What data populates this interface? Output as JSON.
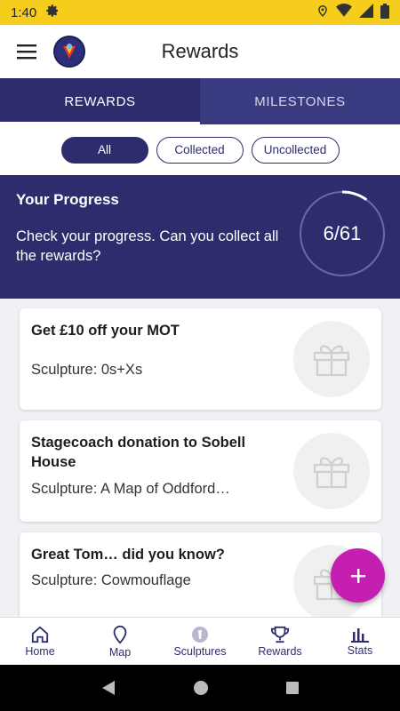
{
  "status_bar": {
    "time": "1:40"
  },
  "app_bar": {
    "title": "Rewards"
  },
  "tabs": [
    {
      "label": "REWARDS",
      "active": true
    },
    {
      "label": "MILESTONES",
      "active": false
    }
  ],
  "filters": {
    "all": "All",
    "collected": "Collected",
    "uncollected": "Uncollected",
    "selected": "All"
  },
  "progress": {
    "title": "Your Progress",
    "text": "Check your progress. Can you collect all the rewards?",
    "count_label": "6/61",
    "collected": 6,
    "total": 61
  },
  "rewards": [
    {
      "title": "Get £10 off your MOT",
      "sculpture": "Sculpture: 0s+Xs"
    },
    {
      "title": "Stagecoach donation to Sobell House",
      "sculpture": "Sculpture: A Map of Oddford…"
    },
    {
      "title": "Great Tom… did you know?",
      "sculpture": "Sculpture: Cowmouflage"
    }
  ],
  "fab": {
    "symbol": "+"
  },
  "bottom_nav": [
    {
      "label": "Home",
      "icon": "home-icon"
    },
    {
      "label": "Map",
      "icon": "map-pin-icon"
    },
    {
      "label": "Sculptures",
      "icon": "sculpture-icon"
    },
    {
      "label": "Rewards",
      "icon": "trophy-icon"
    },
    {
      "label": "Stats",
      "icon": "bar-chart-icon"
    }
  ],
  "colors": {
    "primary": "#2d2d6e",
    "status_bar": "#f6cd1c",
    "fab": "#c41fb0"
  }
}
